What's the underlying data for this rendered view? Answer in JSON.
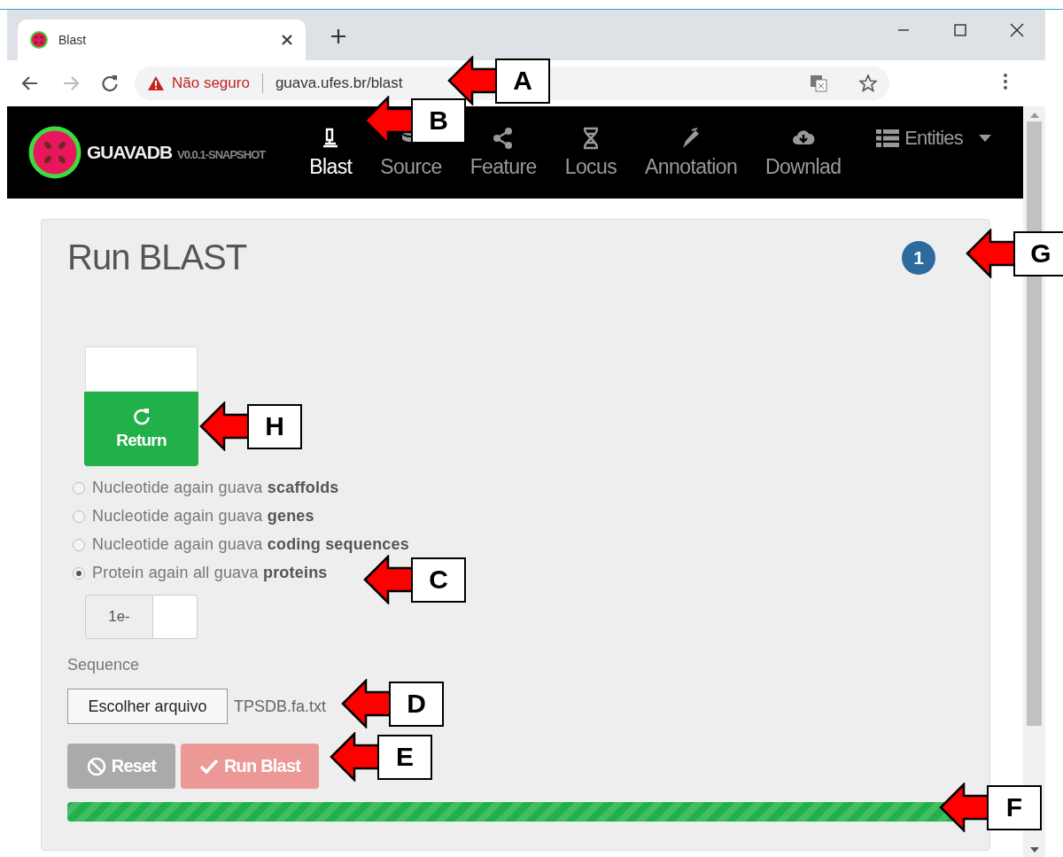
{
  "browser": {
    "tab": {
      "title": "Blast"
    },
    "address": {
      "security_label": "Não seguro",
      "url": "guava.ufes.br/blast"
    }
  },
  "navbar": {
    "brand": "GUAVADB",
    "version": "V0.0.1-SNAPSHOT",
    "items": [
      {
        "label": "Blast",
        "selected": true
      },
      {
        "label": "Source",
        "selected": false
      },
      {
        "label": "Feature",
        "selected": false
      },
      {
        "label": "Locus",
        "selected": false
      },
      {
        "label": "Annotation",
        "selected": false
      },
      {
        "label": "Downlad",
        "selected": false
      }
    ],
    "dropdown": {
      "label": "Entities"
    }
  },
  "panel": {
    "title": "Run BLAST",
    "badge": "1",
    "return_button": "Return",
    "options": [
      {
        "label": "Nucleotide again guava **scaffolds**",
        "selected": false
      },
      {
        "label": "Nucleotide again guava **genes**",
        "selected": false
      },
      {
        "label": "Nucleotide again guava **coding sequences**",
        "selected": false
      },
      {
        "label": "Protein again all guava **proteins**",
        "selected": true
      }
    ],
    "evalue": {
      "prefix": "1e-"
    },
    "sequence": {
      "label": "Sequence",
      "button": "Escolher arquivo",
      "file_name": "TPSDB.fa.txt"
    },
    "buttons": [
      {
        "label": "Reset",
        "kind": "reset",
        "disabled": false
      },
      {
        "label": "Run Blast",
        "kind": "run",
        "disabled": true
      }
    ],
    "progress": {
      "level": 1
    }
  },
  "callouts": [
    {
      "label": "A"
    },
    {
      "label": "B"
    },
    {
      "label": "G"
    },
    {
      "label": "H"
    },
    {
      "label": "C"
    },
    {
      "label": "D"
    },
    {
      "label": "E"
    },
    {
      "label": "F"
    }
  ]
}
